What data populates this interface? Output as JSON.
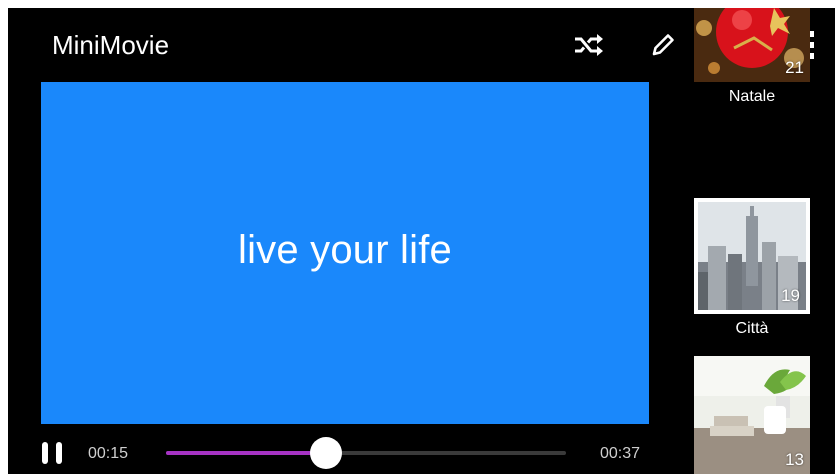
{
  "app": {
    "title": "MiniMovie"
  },
  "toolbar": {
    "shuffle_icon": "shuffle-icon",
    "edit_icon": "pencil-icon",
    "save_icon": "save-icon",
    "more_icon": "more-vertical-icon"
  },
  "player": {
    "overlay_text": "live your life",
    "background_color": "#1a88fb",
    "current_time": "00:15",
    "total_time": "00:37",
    "progress": 0.4,
    "progress_color": "#a633c4"
  },
  "albums": [
    {
      "label": "Natale",
      "count": "21"
    },
    {
      "label": "Città",
      "count": "19",
      "selected": true
    },
    {
      "label": "",
      "count": "13"
    }
  ]
}
